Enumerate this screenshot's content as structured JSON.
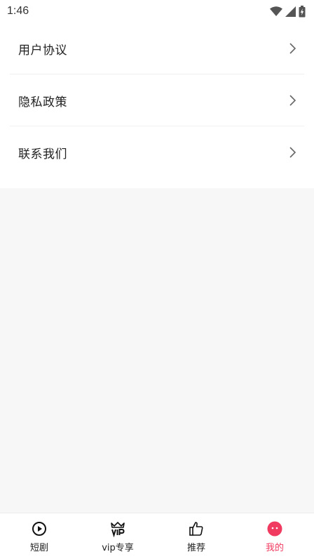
{
  "status_bar": {
    "time": "1:46",
    "icons": [
      "wifi-icon",
      "cellular-signal-icon",
      "battery-icon"
    ]
  },
  "menu": {
    "items": [
      {
        "label": "用户协议",
        "icon": "chevron-right-icon"
      },
      {
        "label": "隐私政策",
        "icon": "chevron-right-icon"
      },
      {
        "label": "联系我们",
        "icon": "chevron-right-icon"
      }
    ]
  },
  "bottom_nav": {
    "items": [
      {
        "label": "短剧",
        "icon": "play-circle-icon",
        "active": false
      },
      {
        "label": "vip专享",
        "icon": "vip-crown-icon",
        "active": false
      },
      {
        "label": "推荐",
        "icon": "thumbs-up-icon",
        "active": false
      },
      {
        "label": "我的",
        "icon": "profile-face-icon",
        "active": true
      }
    ]
  },
  "colors": {
    "accent": "#f03a5f",
    "background": "#f7f7f7",
    "surface": "#ffffff"
  }
}
